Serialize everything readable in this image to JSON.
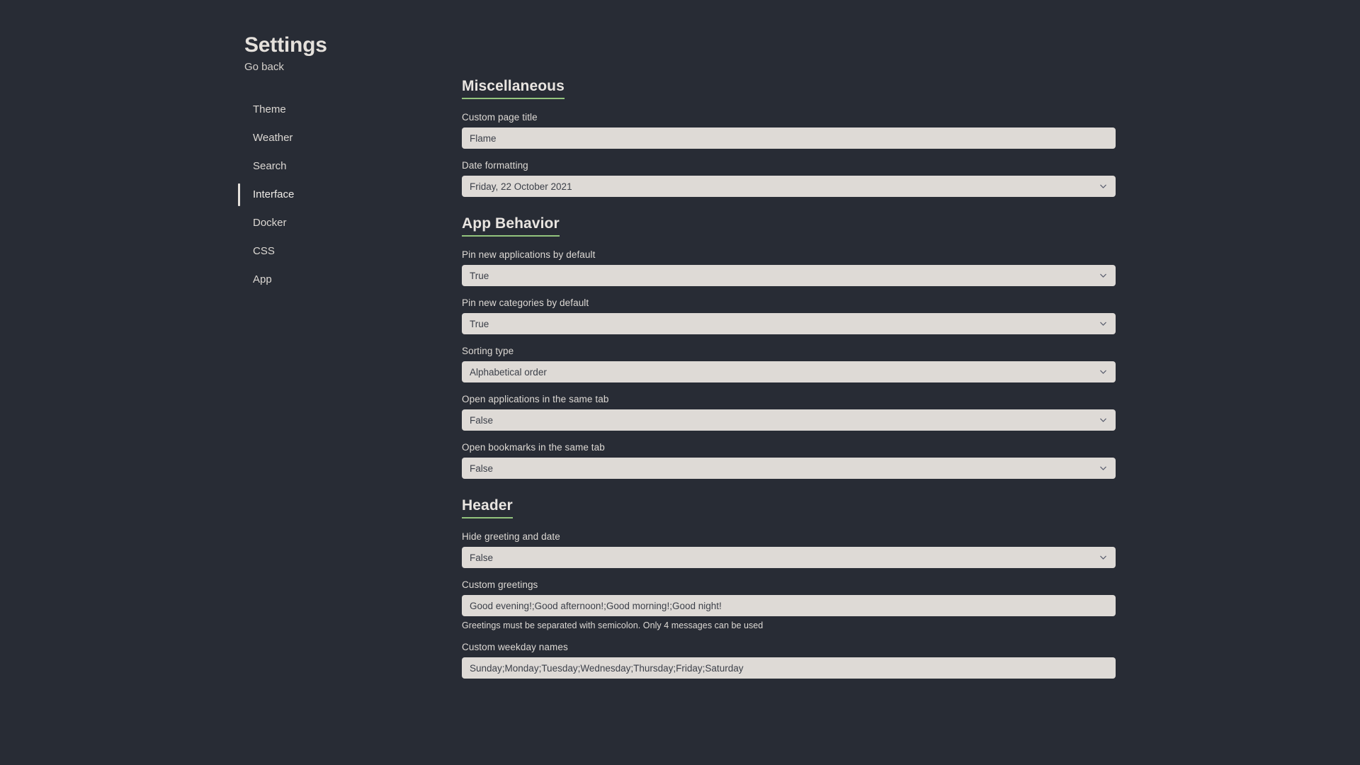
{
  "sidebar": {
    "title": "Settings",
    "go_back_label": "Go back",
    "items": [
      {
        "label": "Theme",
        "active": false
      },
      {
        "label": "Weather",
        "active": false
      },
      {
        "label": "Search",
        "active": false
      },
      {
        "label": "Interface",
        "active": true
      },
      {
        "label": "Docker",
        "active": false
      },
      {
        "label": "CSS",
        "active": false
      },
      {
        "label": "App",
        "active": false
      }
    ]
  },
  "colors": {
    "background": "#282c35",
    "accent_green": "#93c47d",
    "input_background": "#dedad6",
    "text_light": "#dedad5"
  },
  "sections": {
    "miscellaneous": {
      "heading": "Miscellaneous",
      "fields": {
        "custom_page_title": {
          "label": "Custom page title",
          "value": "Flame",
          "type": "text"
        },
        "date_formatting": {
          "label": "Date formatting",
          "value": "Friday, 22 October 2021",
          "type": "select"
        }
      }
    },
    "app_behavior": {
      "heading": "App Behavior",
      "fields": {
        "pin_new_applications": {
          "label": "Pin new applications by default",
          "value": "True",
          "type": "select"
        },
        "pin_new_categories": {
          "label": "Pin new categories by default",
          "value": "True",
          "type": "select"
        },
        "sorting_type": {
          "label": "Sorting type",
          "value": "Alphabetical order",
          "type": "select"
        },
        "open_apps_same_tab": {
          "label": "Open applications in the same tab",
          "value": "False",
          "type": "select"
        },
        "open_bookmarks_same_tab": {
          "label": "Open bookmarks in the same tab",
          "value": "False",
          "type": "select"
        }
      }
    },
    "header": {
      "heading": "Header",
      "fields": {
        "hide_greeting_and_date": {
          "label": "Hide greeting and date",
          "value": "False",
          "type": "select"
        },
        "custom_greetings": {
          "label": "Custom greetings",
          "value": "Good evening!;Good afternoon!;Good morning!;Good night!",
          "type": "text",
          "helper": "Greetings must be separated with semicolon. Only 4 messages can be used"
        },
        "custom_weekday_names": {
          "label": "Custom weekday names",
          "value": "Sunday;Monday;Tuesday;Wednesday;Thursday;Friday;Saturday",
          "type": "text"
        }
      }
    }
  },
  "icons": {
    "chevron_down": "chevron-down-icon"
  }
}
